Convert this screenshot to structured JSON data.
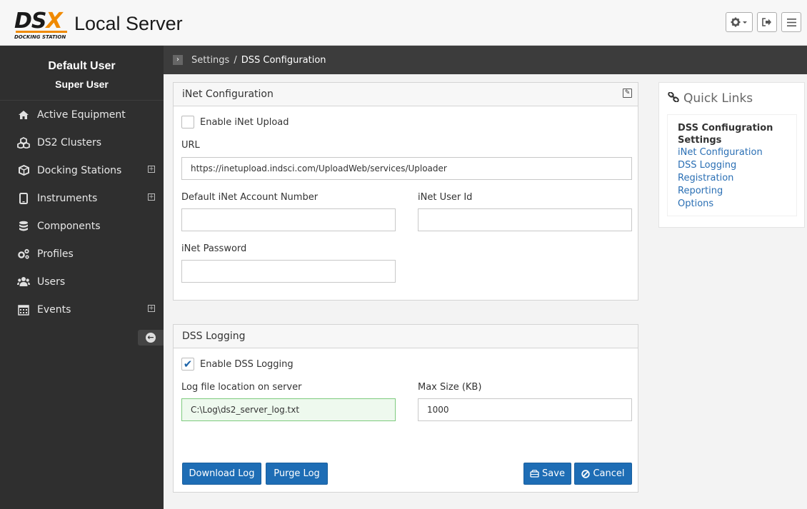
{
  "header": {
    "logo_mark": "DS",
    "logo_mark_x": "X",
    "logo_sub": "DOCKING STATION",
    "app_title": "Local Server",
    "settings_icon": "gear-dropdown-icon",
    "logout_icon": "sign-out-icon",
    "menu_icon": "hamburger-menu-icon"
  },
  "sidebar": {
    "user_name": "Default User",
    "user_role": "Super User",
    "items": [
      {
        "label": "Active Equipment",
        "icon": "home-icon",
        "expandable": false
      },
      {
        "label": "DS2 Clusters",
        "icon": "cubes-icon",
        "expandable": false
      },
      {
        "label": "Docking Stations",
        "icon": "cube-icon",
        "expandable": true
      },
      {
        "label": "Instruments",
        "icon": "tablet-icon",
        "expandable": true
      },
      {
        "label": "Components",
        "icon": "database-icon",
        "expandable": false
      },
      {
        "label": "Profiles",
        "icon": "cogs-icon",
        "expandable": false
      },
      {
        "label": "Users",
        "icon": "users-icon",
        "expandable": false
      },
      {
        "label": "Events",
        "icon": "calendar-icon",
        "expandable": true
      }
    ]
  },
  "breadcrumb": {
    "parent": "Settings",
    "separator": "/",
    "current": "DSS Configuration"
  },
  "inet": {
    "title": "iNet Configuration",
    "enable_label": "Enable iNet Upload",
    "enable_checked": false,
    "url_label": "URL",
    "url_value": "https://inetupload.indsci.com/UploadWeb/services/Uploader",
    "account_label": "Default iNet Account Number",
    "account_value": "",
    "userid_label": "iNet User Id",
    "userid_value": "",
    "password_label": "iNet Password",
    "password_value": ""
  },
  "logging": {
    "title": "DSS Logging",
    "enable_label": "Enable DSS Logging",
    "enable_checked": true,
    "location_label": "Log file location on server",
    "location_value": "C:\\Log\\ds2_server_log.txt",
    "maxsize_label": "Max Size (KB)",
    "maxsize_value": "1000",
    "download_label": "Download Log",
    "purge_label": "Purge Log",
    "save_label": "Save",
    "cancel_label": "Cancel"
  },
  "quick_links": {
    "title": "Quick Links",
    "heading": "DSS Confiugration Settings",
    "links": [
      "iNet Configuration",
      "DSS Logging",
      "Registration",
      "Reporting",
      "Options"
    ]
  },
  "colors": {
    "sidebar_bg": "#2f2f2f",
    "breadcrumb_bg": "#3c3c3c",
    "primary_button": "#1e6db5",
    "brand_accent": "#f08a00",
    "link": "#2a6fb4"
  }
}
